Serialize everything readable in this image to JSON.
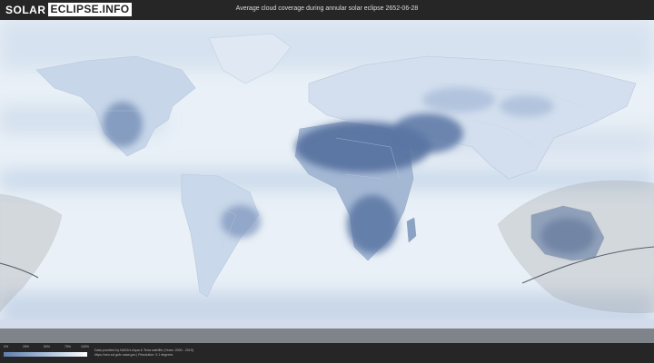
{
  "header": {
    "logo_part1": "SOLAR",
    "logo_part2": "ECLIPSE.INFO",
    "title": "Average cloud coverage during annular solar eclipse 2652-06-28"
  },
  "legend": {
    "labels": [
      "0%",
      "25%",
      "50%",
      "75%",
      "100%"
    ]
  },
  "footer": {
    "credit_line1": "Data provided by NASA's Aqua & Terra satellite (Years: 2000 - 2019)",
    "credit_line2": "https://neo.sci.gsfc.nasa.gov | Resolution: 0.1 degrees"
  },
  "map": {
    "background_color": "#e7eef6",
    "cloudy_color": "#dde7f2",
    "clear_land_color": "#55709f",
    "partial_land_color": "#9db3d2",
    "eclipse_shadow_color": "#9a9a9a"
  }
}
